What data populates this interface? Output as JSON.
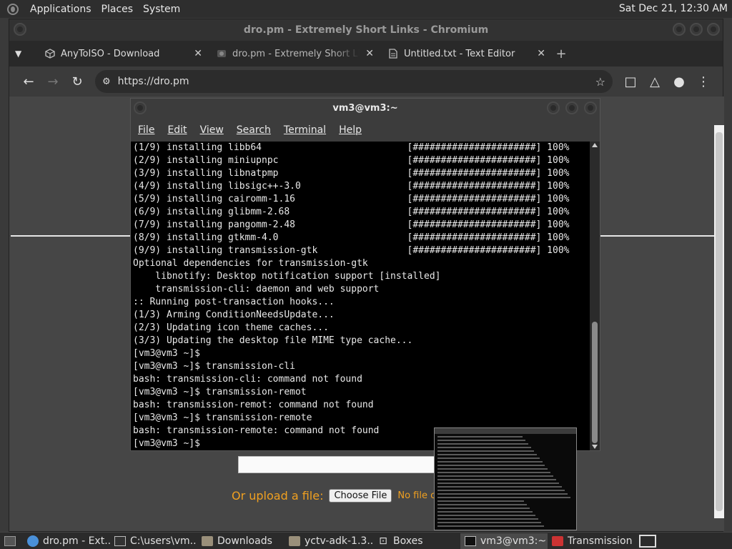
{
  "top_panel": {
    "menus": [
      "Applications",
      "Places",
      "System"
    ],
    "clock": "Sat Dec 21, 12:30 AM"
  },
  "browser": {
    "window_title": "dro.pm - Extremely Short Links - Chromium",
    "tabs": [
      {
        "label": "AnyToISO - Download",
        "icon": "cube-icon"
      },
      {
        "label": "dro.pm - Extremely Short Links - Chromium",
        "icon": "dropm-icon"
      },
      {
        "label": "Untitled.txt - Text Editor",
        "icon": "document-icon"
      }
    ],
    "url": "https://dro.pm",
    "upload_label": "Or upload a file:",
    "choose_file": "Choose File",
    "no_file": "No file chosen"
  },
  "terminal": {
    "title": "vm3@vm3:~",
    "menu": [
      "File",
      "Edit",
      "View",
      "Search",
      "Terminal",
      "Help"
    ],
    "lines": [
      "(1/9) installing libb64                          [######################] 100%",
      "(2/9) installing miniupnpc                       [######################] 100%",
      "(3/9) installing libnatpmp                       [######################] 100%",
      "(4/9) installing libsigc++-3.0                   [######################] 100%",
      "(5/9) installing cairomm-1.16                    [######################] 100%",
      "(6/9) installing glibmm-2.68                     [######################] 100%",
      "(7/9) installing pangomm-2.48                    [######################] 100%",
      "(8/9) installing gtkmm-4.0                       [######################] 100%",
      "(9/9) installing transmission-gtk                [######################] 100%",
      "Optional dependencies for transmission-gtk",
      "    libnotify: Desktop notification support [installed]",
      "    transmission-cli: daemon and web support",
      ":: Running post-transaction hooks...",
      "(1/3) Arming ConditionNeedsUpdate...",
      "(2/3) Updating icon theme caches...",
      "(3/3) Updating the desktop file MIME type cache...",
      "[vm3@vm3 ~]$",
      "[vm3@vm3 ~]$ transmission-cli",
      "bash: transmission-cli: command not found",
      "[vm3@vm3 ~]$ transmission-remot",
      "bash: transmission-remot: command not found",
      "[vm3@vm3 ~]$ transmission-remote",
      "bash: transmission-remote: command not found",
      "[vm3@vm3 ~]$"
    ]
  },
  "taskbar": {
    "items": [
      {
        "label": "dro.pm - Ext...",
        "icon": "chromium-icon"
      },
      {
        "label": "C:\\users\\vm...",
        "icon": "wine-icon"
      },
      {
        "label": "Downloads",
        "icon": "folder-icon"
      },
      {
        "label": "yctv-adk-1.3...",
        "icon": "folder-icon"
      },
      {
        "label": "Boxes",
        "icon": "boxes-icon"
      },
      {
        "label": "vm3@vm3:~",
        "icon": "terminal-icon"
      },
      {
        "label": "Transmission",
        "icon": "transmission-icon"
      }
    ]
  },
  "colors": {
    "accent": "#f0a020",
    "terminal_bg": "#000000",
    "panel_bg": "#2e2e2e"
  }
}
